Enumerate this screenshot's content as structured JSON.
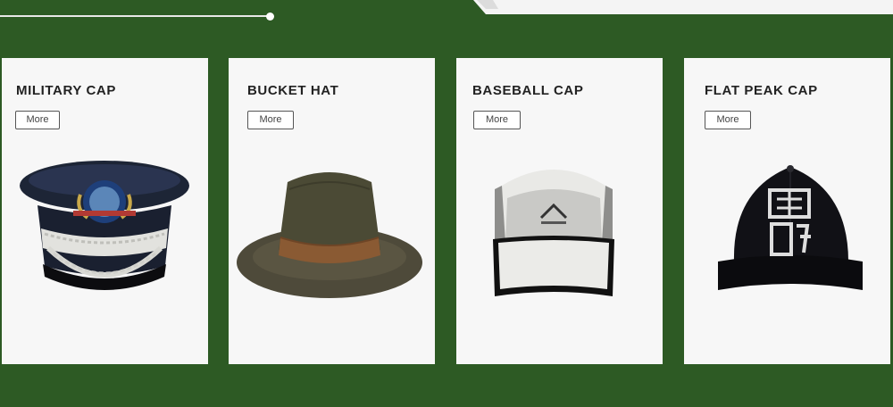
{
  "products": [
    {
      "title": "MILITARY CAP",
      "more_label": "More",
      "hat_icon": "military-cap-icon"
    },
    {
      "title": "BUCKET HAT",
      "more_label": "More",
      "hat_icon": "bucket-hat-icon"
    },
    {
      "title": "BASEBALL CAP",
      "more_label": "More",
      "hat_icon": "baseball-cap-icon"
    },
    {
      "title": "FLAT PEAK CAP",
      "more_label": "More",
      "hat_icon": "flat-peak-cap-icon"
    }
  ],
  "colors": {
    "background": "#2d5a24",
    "card": "#f7f7f7",
    "text": "#222222"
  }
}
